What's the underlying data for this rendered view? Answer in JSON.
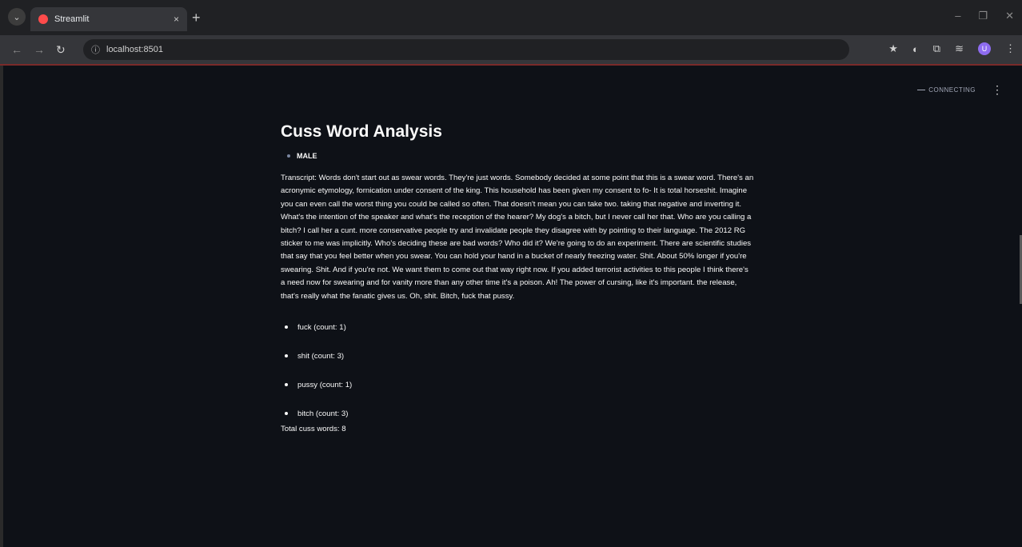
{
  "browser": {
    "tab_title": "Streamlit",
    "tab_close": "×",
    "new_tab": "+",
    "url": "localhost:8501",
    "profile_initial": "U"
  },
  "app": {
    "status": "CONNECTING",
    "title": "Cuss Word Analysis",
    "gender": "MALE",
    "transcript": "Transcript: Words don't start out as swear words. They're just words. Somebody decided at some point that this is a swear word. There's an acronymic etymology, fornication under consent of the king. This household has been given my consent to fo- It is total horseshit. Imagine you can even call the worst thing you could be called so often. That doesn't mean you can take two. taking that negative and inverting it. What's the intention of the speaker and what's the reception of the hearer? My dog's a bitch, but I never call her that. Who are you calling a bitch? I call her a cunt. more conservative people try and invalidate people they disagree with by pointing to their language. The 2012 RG sticker to me was implicitly. Who's deciding these are bad words? Who did it? We're going to do an experiment. There are scientific studies that say that you feel better when you swear. You can hold your hand in a bucket of nearly freezing water. Shit. About 50% longer if you're swearing. Shit. And if you're not. We want them to come out that way right now. If you added terrorist activities to this people I think there's a need now for swearing and for vanity more than any other time it's a poison. Ah! The power of cursing, like it's important. the release, that's really what the fanatic gives us. Oh, shit. Bitch, fuck that pussy.",
    "cuss_words": [
      "fuck (count: 1)",
      "shit (count: 3)",
      "pussy (count: 1)",
      "bitch (count: 3)"
    ],
    "total": "Total cuss words: 8"
  },
  "colors": {
    "background": "#0e1117",
    "accent": "#ff4b4b"
  }
}
